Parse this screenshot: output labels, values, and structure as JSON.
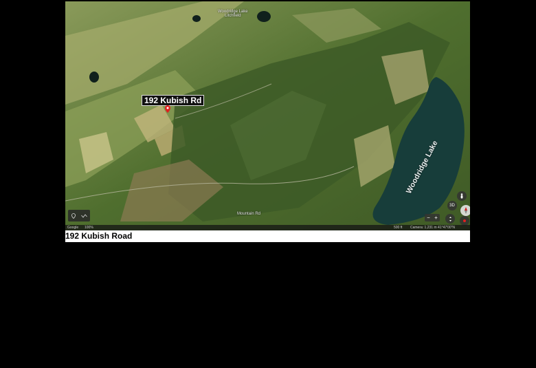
{
  "map": {
    "place_label": "192 Kubish Rd",
    "lake_label": "Woodridge Lake",
    "top_town_label": "Woodridge Lake\nLitchfield",
    "road_label": "Mountain Rd",
    "toolbar_icons": [
      "location-icon",
      "path-icon"
    ],
    "status": {
      "google": "Google",
      "percent": "100%",
      "scale": "500 ft",
      "camera": "Camera: 1,231 m  41°47'00\"N 73°11'01\"W"
    },
    "nav_buttons": {
      "person": "person-icon",
      "three_d": "3D",
      "compass": "compass-icon",
      "zoom_minus": "−",
      "zoom_plus": "+"
    },
    "colors": {
      "pin": "#e02020",
      "lake": "#173d3a",
      "label_bg": "#111111"
    }
  },
  "caption": "192 Kubish Road"
}
